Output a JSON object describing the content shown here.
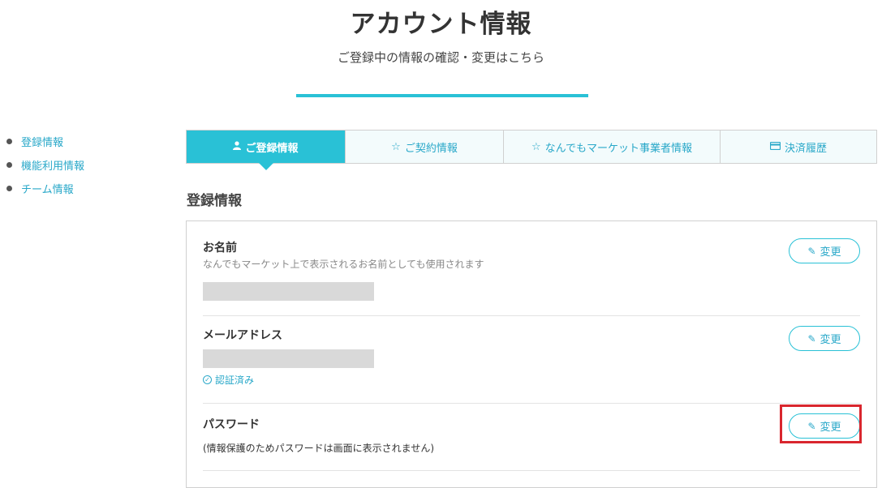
{
  "header": {
    "title": "アカウント情報",
    "subtitle": "ご登録中の情報の確認・変更はこちら"
  },
  "side_nav": {
    "items": [
      {
        "label": "登録情報"
      },
      {
        "label": "機能利用情報"
      },
      {
        "label": "チーム情報"
      }
    ]
  },
  "tabs": [
    {
      "label": "ご登録情報",
      "icon": "user-icon",
      "active": true
    },
    {
      "label": "ご契約情報",
      "icon": "star-outline-icon",
      "active": false
    },
    {
      "label": "なんでもマーケット事業者情報",
      "icon": "star-outline-icon",
      "active": false
    },
    {
      "label": "決済履歴",
      "icon": "credit-card-icon",
      "active": false
    }
  ],
  "section": {
    "title": "登録情報"
  },
  "fields": {
    "name": {
      "label": "お名前",
      "description": "なんでもマーケット上で表示されるお名前としても使用されます",
      "value_masked": true,
      "edit_label": "変更"
    },
    "email": {
      "label": "メールアドレス",
      "value_masked": true,
      "verified_label": "認証済み",
      "edit_label": "変更"
    },
    "password": {
      "label": "パスワード",
      "note": "(情報保護のためパスワードは画面に表示されません)",
      "edit_label": "変更",
      "highlighted": true
    }
  },
  "colors": {
    "accent": "#29c1d6",
    "link": "#29a8c9",
    "highlight": "#d9262e",
    "masked": "#d9d9d9"
  }
}
